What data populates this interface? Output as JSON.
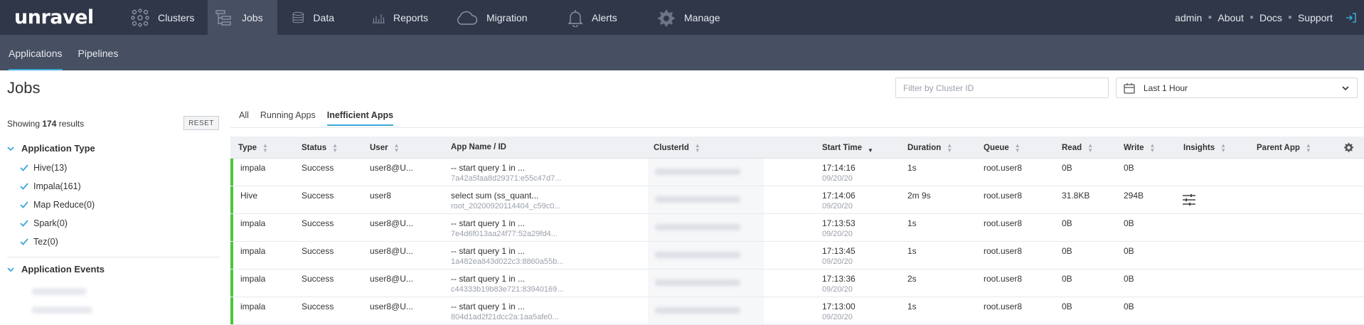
{
  "app": {
    "logo": "unravel"
  },
  "nav": {
    "items": [
      {
        "label": "Clusters",
        "icon": "clusters-icon"
      },
      {
        "label": "Jobs",
        "icon": "jobs-icon",
        "active": true
      },
      {
        "label": "Data",
        "icon": "data-icon"
      },
      {
        "label": "Reports",
        "icon": "reports-icon"
      },
      {
        "label": "Migration",
        "icon": "cloud-icon"
      },
      {
        "label": "Alerts",
        "icon": "bell-icon"
      },
      {
        "label": "Manage",
        "icon": "gear-icon"
      }
    ],
    "right": {
      "user": "admin",
      "about": "About",
      "docs": "Docs",
      "support": "Support"
    }
  },
  "subnav": {
    "tabs": [
      "Applications",
      "Pipelines"
    ],
    "active": "Applications"
  },
  "page": {
    "title": "Jobs",
    "cluster_filter_placeholder": "Filter by Cluster ID",
    "time_range": "Last 1 Hour"
  },
  "sidebar": {
    "showing_prefix": "Showing",
    "showing_count": "174",
    "showing_suffix": "results",
    "reset": "RESET",
    "application_type": {
      "title": "Application Type",
      "items": [
        "Hive(13)",
        "Impala(161)",
        "Map Reduce(0)",
        "Spark(0)",
        "Tez(0)"
      ]
    },
    "application_events": {
      "title": "Application Events"
    }
  },
  "tabs": [
    "All",
    "Running Apps",
    "Inefficient Apps"
  ],
  "active_tab": "Inefficient Apps",
  "table": {
    "columns": [
      "Type",
      "Status",
      "User",
      "App Name / ID",
      "ClusterId",
      "Start Time",
      "Duration",
      "Queue",
      "Read",
      "Write",
      "Insights",
      "Parent App"
    ],
    "rows": [
      {
        "type": "impala",
        "status": "Success",
        "user": "user8@U...",
        "app_name": "-- start query 1 in ...",
        "app_id": "7a42a5faa8d29371:e55c47d7...",
        "start_time": "17:14:16",
        "start_date": "09/20/20",
        "duration": "1s",
        "queue": "root.user8",
        "read": "0B",
        "write": "0B"
      },
      {
        "type": "Hive",
        "status": "Success",
        "user": "user8",
        "app_name": "select sum (ss_quant...",
        "app_id": "root_20200920114404_c59c0...",
        "start_time": "17:14:06",
        "start_date": "09/20/20",
        "duration": "2m 9s",
        "queue": "root.user8",
        "read": "31.8KB",
        "write": "294B",
        "insight": "sliders-icon"
      },
      {
        "type": "impala",
        "status": "Success",
        "user": "user8@U...",
        "app_name": "-- start query 1 in ...",
        "app_id": "7e4d6f013aa24f77:52a29fd4...",
        "start_time": "17:13:53",
        "start_date": "09/20/20",
        "duration": "1s",
        "queue": "root.user8",
        "read": "0B",
        "write": "0B"
      },
      {
        "type": "impala",
        "status": "Success",
        "user": "user8@U...",
        "app_name": "-- start query 1 in ...",
        "app_id": "1a482ea843d022c3:8860a55b...",
        "start_time": "17:13:45",
        "start_date": "09/20/20",
        "duration": "1s",
        "queue": "root.user8",
        "read": "0B",
        "write": "0B"
      },
      {
        "type": "impala",
        "status": "Success",
        "user": "user8@U...",
        "app_name": "-- start query 1 in ...",
        "app_id": "c44333b19b83e721:83940169...",
        "start_time": "17:13:36",
        "start_date": "09/20/20",
        "duration": "2s",
        "queue": "root.user8",
        "read": "0B",
        "write": "0B"
      },
      {
        "type": "impala",
        "status": "Success",
        "user": "user8@U...",
        "app_name": "-- start query 1 in ...",
        "app_id": "804d1ad2f21dcc2a:1aa5afe0...",
        "start_time": "17:13:00",
        "start_date": "09/20/20",
        "duration": "1s",
        "queue": "root.user8",
        "read": "0B",
        "write": "0B"
      }
    ]
  },
  "colors": {
    "nav_bg": "#2f3749",
    "subnav_bg": "#474f62",
    "accent": "#3ba7d8",
    "success_bar": "#4cc53b",
    "checkbox": "#3ba7d8"
  }
}
